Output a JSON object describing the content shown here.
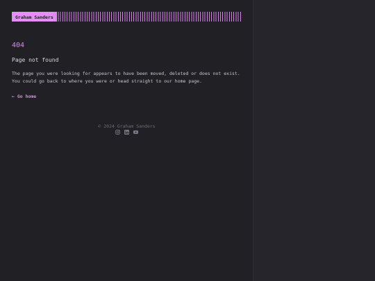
{
  "header": {
    "logo_text": "Graham Sanders"
  },
  "error": {
    "code": "404",
    "title": "Page not found",
    "message": "The page you were looking for appears to have been moved, deleted or does not exist. You could go back to where you were or head straight to our home page."
  },
  "actions": {
    "go_home_label": "← Go home"
  },
  "footer": {
    "copyright": "© 2024 Graham Sanders",
    "social_icons": [
      "instagram-icon",
      "linkedin-icon",
      "youtube-icon"
    ]
  },
  "colors": {
    "background": "#212025",
    "side_panel": "#26252b",
    "accent": "#e48ff5",
    "text": "#d9d8de",
    "muted": "#6f6d78"
  }
}
